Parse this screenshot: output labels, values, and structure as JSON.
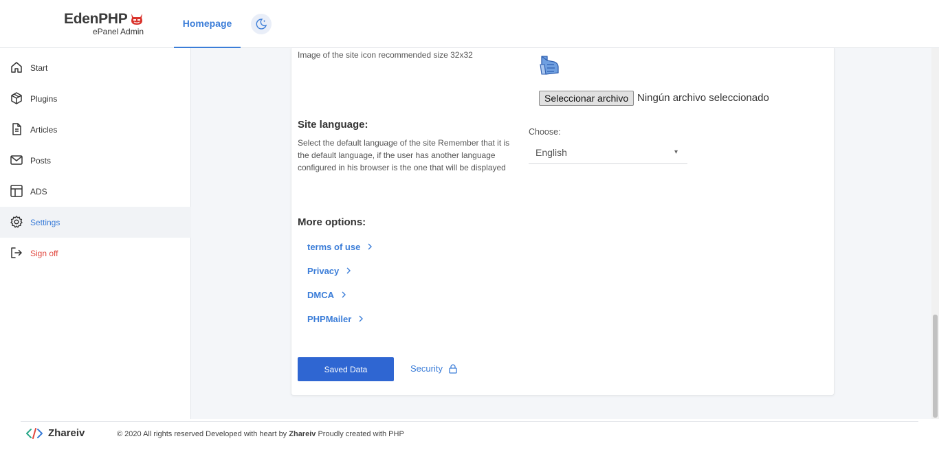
{
  "header": {
    "logo_title": "EdenPHP",
    "logo_subtitle": "ePanel Admin",
    "nav_tab": "Homepage",
    "theme_icon": "moon-icon"
  },
  "sidebar": {
    "items": [
      {
        "label": "Start",
        "icon": "home-icon"
      },
      {
        "label": "Plugins",
        "icon": "box-icon"
      },
      {
        "label": "Articles",
        "icon": "document-icon"
      },
      {
        "label": "Posts",
        "icon": "mail-icon"
      },
      {
        "label": "ADS",
        "icon": "layout-icon"
      },
      {
        "label": "Settings",
        "icon": "gear-icon",
        "active": true
      },
      {
        "label": "Sign off",
        "icon": "logout-icon"
      }
    ]
  },
  "main": {
    "site_icon": {
      "description": "Image of the site icon recommended size 32x32",
      "file_button": "Seleccionar archivo",
      "file_status": "Ningún archivo seleccionado"
    },
    "language": {
      "title": "Site language:",
      "description": "Select the default language of the site Remember that it is the default language, if the user has another language configured in his browser is the one that will be displayed",
      "choose_label": "Choose:",
      "selected": "English"
    },
    "more_options": {
      "title": "More options:",
      "links": [
        "terms of use",
        "Privacy",
        "DMCA",
        "PHPMailer"
      ]
    },
    "save_button": "Saved Data",
    "security_link": "Security"
  },
  "footer": {
    "brand": "Zhareiv",
    "copyright_prefix": "© 2020 All rights reserved Developed with heart by ",
    "copyright_author": "Zhareiv",
    "copyright_suffix": " Proudly created with PHP"
  },
  "colors": {
    "accent": "#3b7dd8",
    "button": "#2f66d2",
    "signoff": "#e0453c",
    "background": "#f4f6f9"
  }
}
